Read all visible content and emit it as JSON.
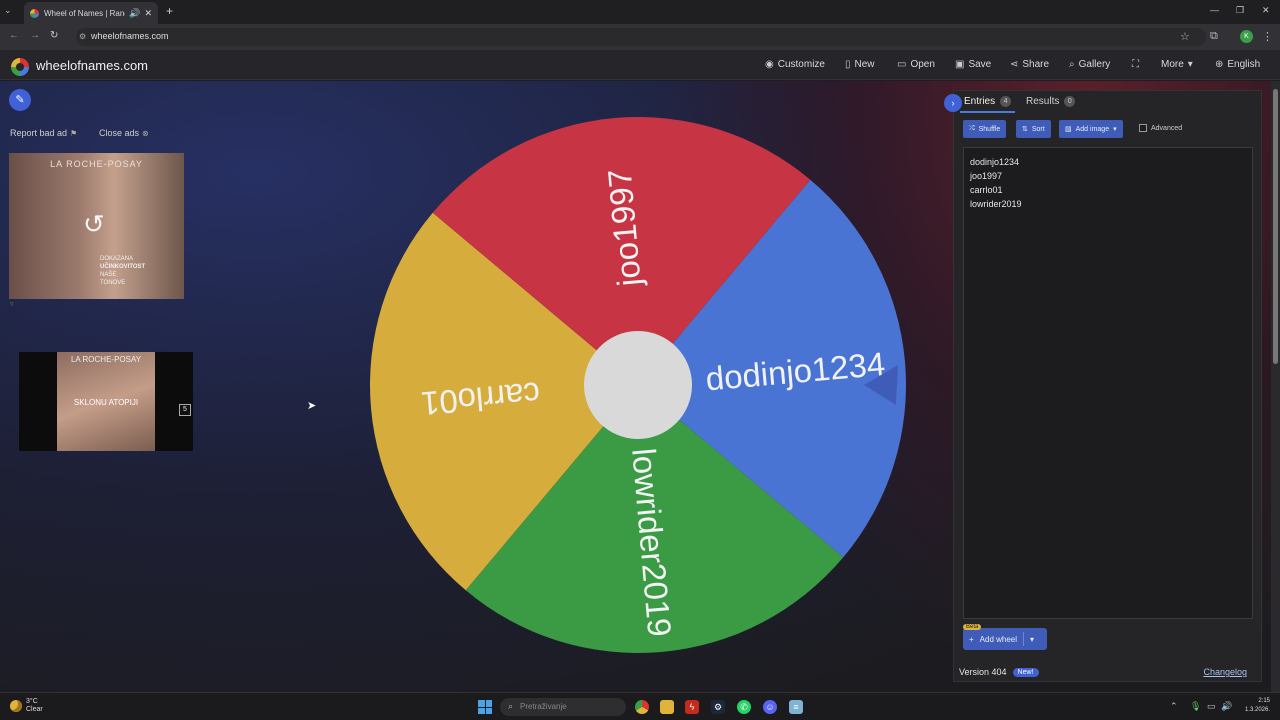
{
  "browser": {
    "tab_title": "Wheel of Names | Random",
    "url": "wheelofnames.com"
  },
  "header": {
    "brand": "wheelofnames.com",
    "menu": [
      {
        "label": "Customize",
        "icon": "palette-icon"
      },
      {
        "label": "New",
        "icon": "file-icon"
      },
      {
        "label": "Open",
        "icon": "folder-icon"
      },
      {
        "label": "Save",
        "icon": "save-icon"
      },
      {
        "label": "Share",
        "icon": "share-icon"
      },
      {
        "label": "Gallery",
        "icon": "search-icon"
      },
      {
        "label": "",
        "icon": "fullscreen-icon"
      },
      {
        "label": "More",
        "icon": "chevron-down-icon"
      },
      {
        "label": "English",
        "icon": "globe-icon"
      }
    ]
  },
  "ads": {
    "report": "Report bad ad",
    "close": "Close ads",
    "ad1_brand": "LA ROCHE-POSAY",
    "ad1_text": [
      "DOKAZANA",
      "UČINKOVITOST",
      "NAŠE",
      "TONOVE"
    ],
    "ad2_brand": "LA ROCHE-POSAY",
    "ad2_text": "SKLONU ATOPIJI",
    "ad2_counter": "5"
  },
  "wheel": {
    "segments": [
      {
        "name": "dodinjo1234",
        "color": "#4a74d4"
      },
      {
        "name": "lowrider2019",
        "color": "#3b9a44"
      },
      {
        "name": "carrlo01",
        "color": "#d6ad3c"
      },
      {
        "name": "joo1997",
        "color": "#c73444"
      }
    ],
    "pointer_color": "#3f5db8",
    "center_color": "#d9d9d9"
  },
  "panel": {
    "tab_entries": "Entries",
    "entries_count": "4",
    "tab_results": "Results",
    "results_count": "0",
    "shuffle": "Shuffle",
    "sort": "Sort",
    "add_image": "Add image",
    "advanced": "Advanced",
    "entries": [
      "dodinjo1234",
      "joo1997",
      "carrlo01",
      "lowrider2019"
    ],
    "beta": "Beta",
    "add_wheel": "Add wheel",
    "version": "Version 404",
    "new_badge": "New!",
    "changelog": "Changelog"
  },
  "taskbar": {
    "temp": "3°C",
    "condition": "Clear",
    "search_placeholder": "Pretraživanje",
    "time": "2:15",
    "date": "1.3.2026."
  }
}
